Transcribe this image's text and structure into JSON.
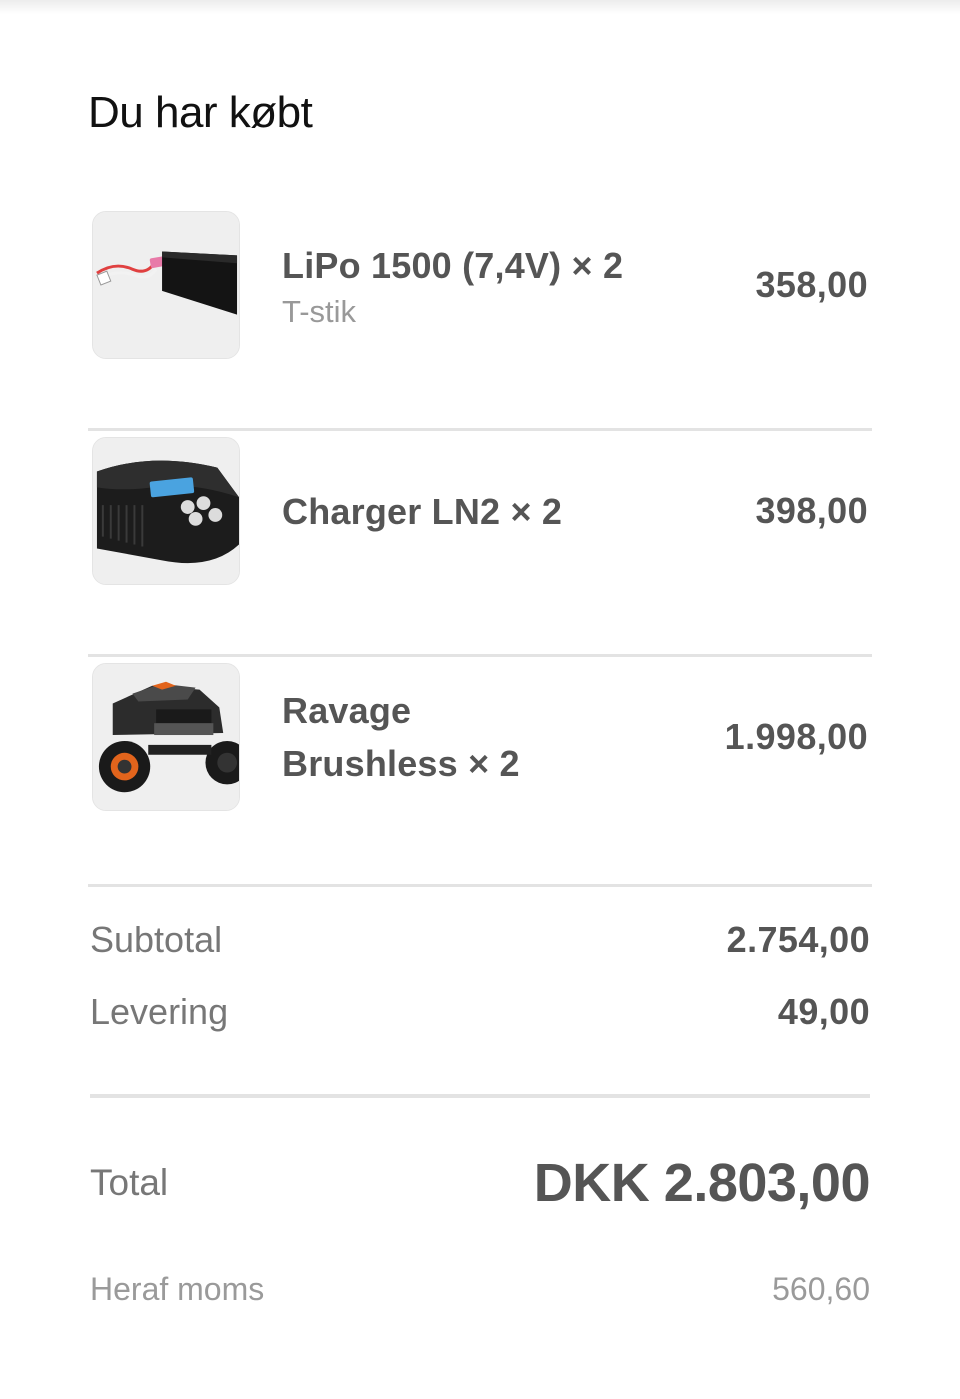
{
  "order": {
    "heading": "Du har købt",
    "items": [
      {
        "name": "LiPo 1500 (7,4V) × 2",
        "variant": "T-stik",
        "price": "358,00",
        "image": "lipo-battery-image"
      },
      {
        "name": "Charger LN2 × 2",
        "variant": "",
        "price": "398,00",
        "image": "charger-image"
      },
      {
        "name": "Ravage Brushless × 2",
        "variant": "",
        "price": "1.998,00",
        "image": "rc-truck-image"
      }
    ],
    "summary": {
      "subtotal_label": "Subtotal",
      "subtotal_value": "2.754,00",
      "delivery_label": "Levering",
      "delivery_value": "49,00"
    },
    "total": {
      "label": "Total",
      "value": "DKK 2.803,00"
    },
    "vat": {
      "label": "Heraf moms",
      "value": "560,60"
    }
  }
}
